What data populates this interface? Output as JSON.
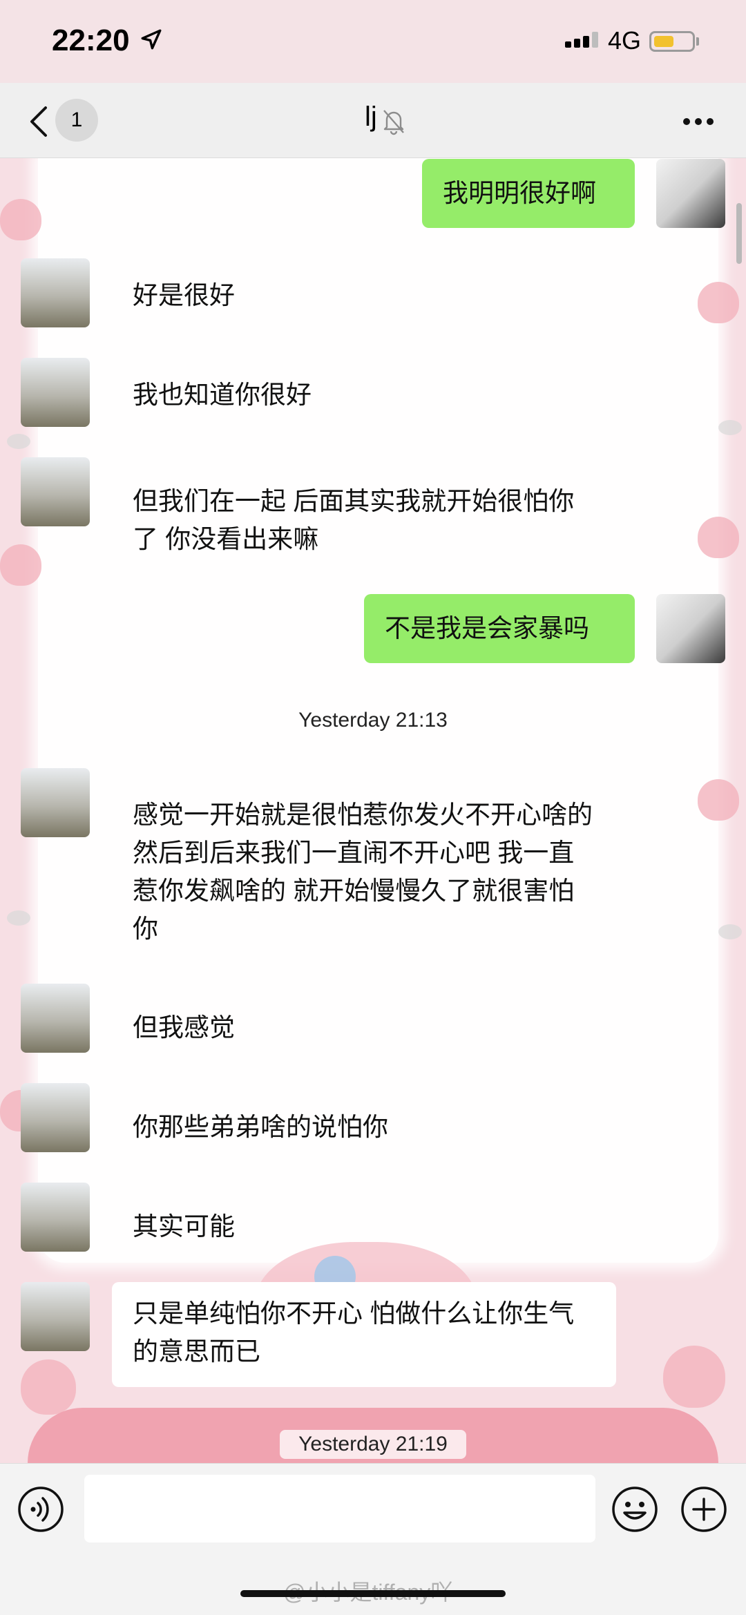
{
  "status_bar": {
    "time": "22:20",
    "network": "4G"
  },
  "nav": {
    "unread_count": "1",
    "title": "lj"
  },
  "messages": [
    {
      "side": "me",
      "text": "我明明很好啊"
    },
    {
      "side": "other",
      "text": "好是很好"
    },
    {
      "side": "other",
      "text": "我也知道你很好"
    },
    {
      "side": "other",
      "text": "但我们在一起 后面其实我就开始很怕你了 你没看出来嘛"
    },
    {
      "side": "me",
      "text": "不是我是会家暴吗"
    },
    {
      "timestamp": "Yesterday 21:13"
    },
    {
      "side": "other",
      "text": "感觉一开始就是很怕惹你发火不开心啥的 然后到后来我们一直闹不开心吧 我一直惹你发飙啥的 就开始慢慢久了就很害怕你"
    },
    {
      "side": "other",
      "text": "但我感觉"
    },
    {
      "side": "other",
      "text": "你那些弟弟啥的说怕你"
    },
    {
      "side": "other",
      "text": "其实可能"
    },
    {
      "side": "other",
      "text": "只是单纯怕你不开心 怕做什么让你生气的意思而已"
    },
    {
      "timestamp": "Yesterday 21:19"
    }
  ],
  "input": {
    "placeholder": ""
  },
  "watermark": "@小小是tiffany吖",
  "icons": {
    "location": "location-arrow-icon",
    "mute": "bell-slash-icon",
    "more": "more-dots-icon",
    "voice": "voice-icon",
    "emoji": "emoji-icon",
    "plus": "plus-icon"
  },
  "colors": {
    "my_bubble": "#95ec69",
    "battery": "#f2c12e",
    "nav_bg": "#efefef"
  }
}
